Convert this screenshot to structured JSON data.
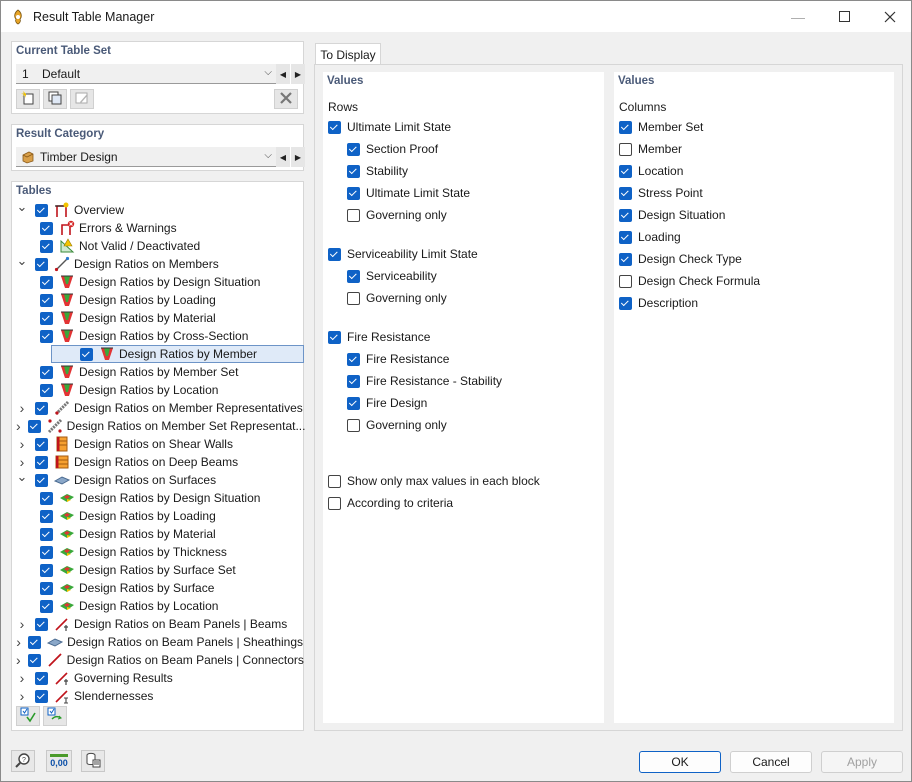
{
  "window": {
    "title": "Result Table Manager"
  },
  "current_table_set": {
    "header": "Current Table Set",
    "number": "1",
    "name": "Default"
  },
  "result_category": {
    "header": "Result Category",
    "value": "Timber Design"
  },
  "tables": {
    "header": "Tables",
    "items": [
      {
        "label": "Overview",
        "level": 0,
        "expander": "open",
        "checked": true,
        "icon": "overview-icon"
      },
      {
        "label": "Errors & Warnings",
        "level": 1,
        "expander": "none",
        "checked": true,
        "icon": "errors-warnings-icon"
      },
      {
        "label": "Not Valid / Deactivated",
        "level": 1,
        "expander": "none",
        "checked": true,
        "icon": "not-valid-icon"
      },
      {
        "label": "Design Ratios on Members",
        "level": 0,
        "expander": "open",
        "checked": true,
        "icon": "member-icon"
      },
      {
        "label": "Design Ratios by Design Situation",
        "level": 1,
        "expander": "none",
        "checked": true,
        "icon": "ratio-member-icon"
      },
      {
        "label": "Design Ratios by Loading",
        "level": 1,
        "expander": "none",
        "checked": true,
        "icon": "ratio-member-icon"
      },
      {
        "label": "Design Ratios by Material",
        "level": 1,
        "expander": "none",
        "checked": true,
        "icon": "ratio-member-icon"
      },
      {
        "label": "Design Ratios by Cross-Section",
        "level": 1,
        "expander": "none",
        "checked": true,
        "icon": "ratio-member-icon"
      },
      {
        "label": "Design Ratios by Member",
        "level": 1,
        "expander": "none",
        "checked": true,
        "icon": "ratio-member-icon",
        "selected": true
      },
      {
        "label": "Design Ratios by Member Set",
        "level": 1,
        "expander": "none",
        "checked": true,
        "icon": "ratio-member-icon"
      },
      {
        "label": "Design Ratios by Location",
        "level": 1,
        "expander": "none",
        "checked": true,
        "icon": "ratio-member-icon"
      },
      {
        "label": "Design Ratios on Member Representatives",
        "level": 0,
        "expander": "closed",
        "checked": true,
        "icon": "member-representative-icon"
      },
      {
        "label": "Design Ratios on Member Set Representat...",
        "level": 0,
        "expander": "closed",
        "checked": true,
        "icon": "member-set-representative-icon"
      },
      {
        "label": "Design Ratios on Shear Walls",
        "level": 0,
        "expander": "closed",
        "checked": true,
        "icon": "shear-wall-icon"
      },
      {
        "label": "Design Ratios on Deep Beams",
        "level": 0,
        "expander": "closed",
        "checked": true,
        "icon": "deep-beam-icon"
      },
      {
        "label": "Design Ratios on Surfaces",
        "level": 0,
        "expander": "open",
        "checked": true,
        "icon": "surface-icon"
      },
      {
        "label": "Design Ratios by Design Situation",
        "level": 1,
        "expander": "none",
        "checked": true,
        "icon": "ratio-surface-icon"
      },
      {
        "label": "Design Ratios by Loading",
        "level": 1,
        "expander": "none",
        "checked": true,
        "icon": "ratio-surface-icon"
      },
      {
        "label": "Design Ratios by Material",
        "level": 1,
        "expander": "none",
        "checked": true,
        "icon": "ratio-surface-icon"
      },
      {
        "label": "Design Ratios by Thickness",
        "level": 1,
        "expander": "none",
        "checked": true,
        "icon": "ratio-surface-icon"
      },
      {
        "label": "Design Ratios by Surface Set",
        "level": 1,
        "expander": "none",
        "checked": true,
        "icon": "ratio-surface-icon"
      },
      {
        "label": "Design Ratios by Surface",
        "level": 1,
        "expander": "none",
        "checked": true,
        "icon": "ratio-surface-icon"
      },
      {
        "label": "Design Ratios by Location",
        "level": 1,
        "expander": "none",
        "checked": true,
        "icon": "ratio-surface-icon"
      },
      {
        "label": "Design Ratios on Beam Panels | Beams",
        "level": 0,
        "expander": "closed",
        "checked": true,
        "icon": "beam-panel-beam-icon"
      },
      {
        "label": "Design Ratios on Beam Panels | Sheathings",
        "level": 0,
        "expander": "closed",
        "checked": true,
        "icon": "beam-panel-sheathing-icon"
      },
      {
        "label": "Design Ratios on Beam Panels | Connectors",
        "level": 0,
        "expander": "closed",
        "checked": true,
        "icon": "beam-panel-connector-icon"
      },
      {
        "label": "Governing Results",
        "level": 0,
        "expander": "closed",
        "checked": true,
        "icon": "governing-results-icon"
      },
      {
        "label": "Slendernesses",
        "level": 0,
        "expander": "closed",
        "checked": true,
        "icon": "slenderness-icon"
      }
    ]
  },
  "to_display": {
    "tab_label": "To Display",
    "rows_panel": {
      "header": "Values",
      "subheader": "Rows",
      "groups": [
        {
          "label": "Ultimate Limit State",
          "checked": true,
          "children": [
            {
              "label": "Section Proof",
              "checked": true
            },
            {
              "label": "Stability",
              "checked": true
            },
            {
              "label": "Ultimate Limit State",
              "checked": true
            },
            {
              "label": "Governing only",
              "checked": false
            }
          ]
        },
        {
          "label": "Serviceability Limit State",
          "checked": true,
          "children": [
            {
              "label": "Serviceability",
              "checked": true
            },
            {
              "label": "Governing only",
              "checked": false
            }
          ]
        },
        {
          "label": "Fire Resistance",
          "checked": true,
          "children": [
            {
              "label": "Fire Resistance",
              "checked": true
            },
            {
              "label": "Fire Resistance - Stability",
              "checked": true
            },
            {
              "label": "Fire Design",
              "checked": true
            },
            {
              "label": "Governing only",
              "checked": false
            }
          ]
        }
      ],
      "options": [
        {
          "label": "Show only max values in each block",
          "checked": false
        },
        {
          "label": "According to criteria",
          "checked": false
        }
      ]
    },
    "columns_panel": {
      "header": "Values",
      "subheader": "Columns",
      "items": [
        {
          "label": "Member Set",
          "checked": true
        },
        {
          "label": "Member",
          "checked": false
        },
        {
          "label": "Location",
          "checked": true
        },
        {
          "label": "Stress Point",
          "checked": true
        },
        {
          "label": "Design Situation",
          "checked": true
        },
        {
          "label": "Loading",
          "checked": true
        },
        {
          "label": "Design Check Type",
          "checked": true
        },
        {
          "label": "Design Check Formula",
          "checked": false
        },
        {
          "label": "Description",
          "checked": true
        }
      ]
    }
  },
  "footer": {
    "ok_label": "OK",
    "cancel_label": "Cancel",
    "apply_label": "Apply",
    "units_icon_text": "0,00"
  }
}
